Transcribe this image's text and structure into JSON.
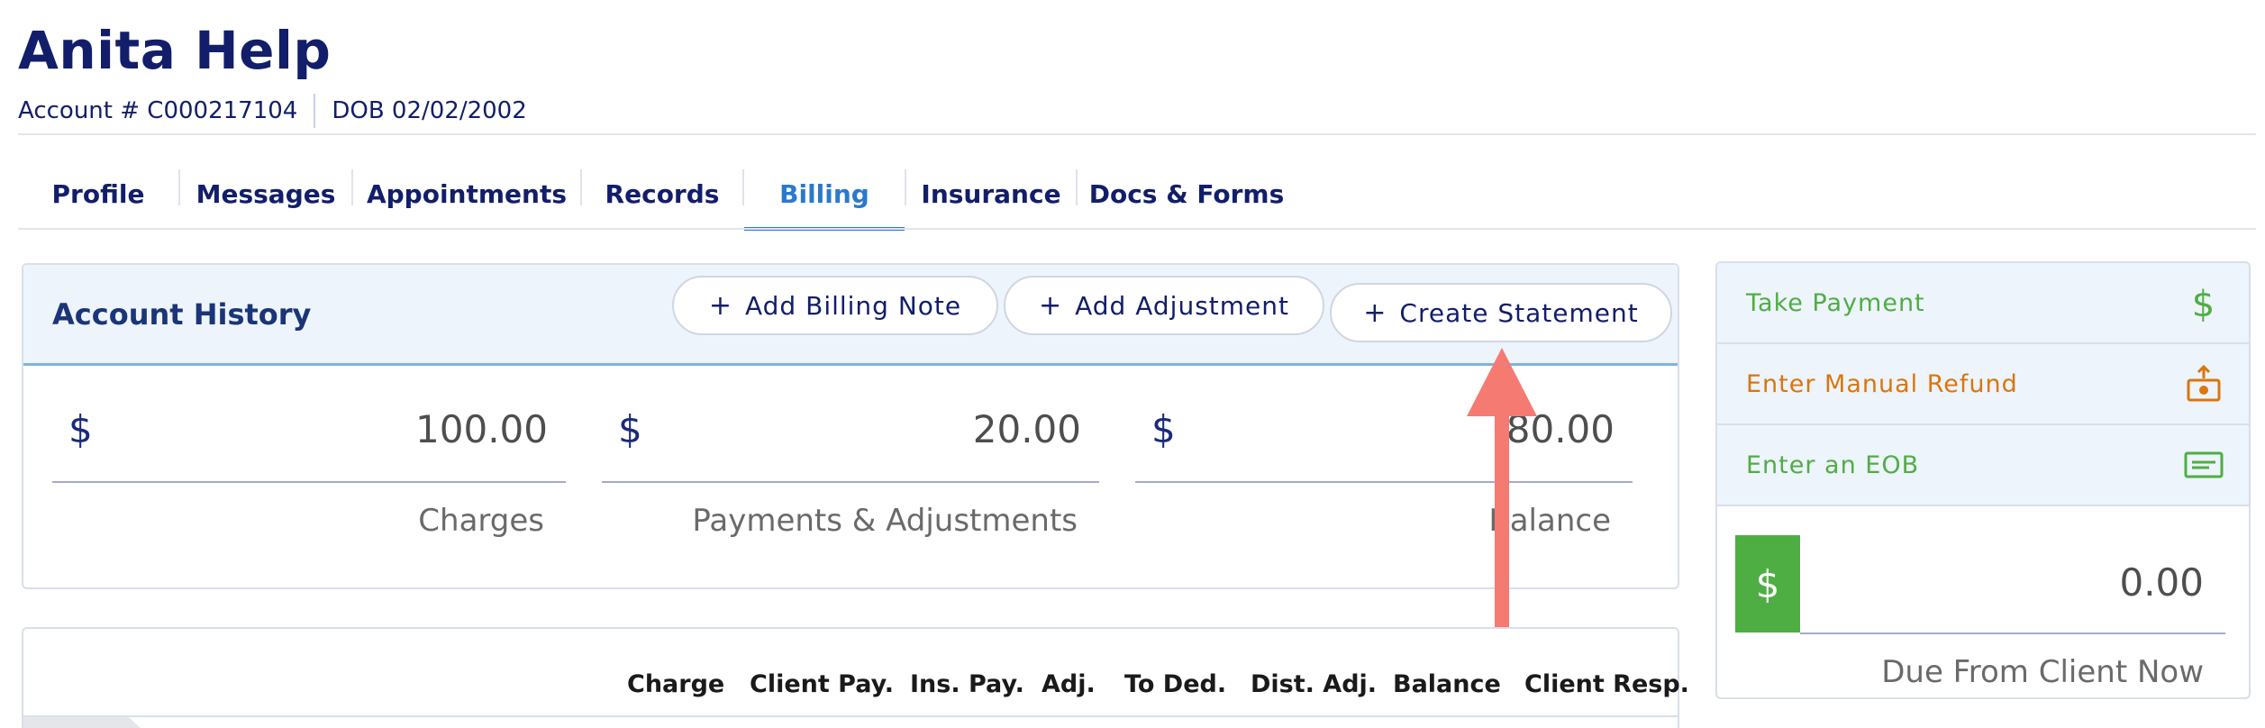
{
  "patient": {
    "name": "Anita Help",
    "account": "Account # C000217104",
    "dob": "DOB 02/02/2002"
  },
  "tabs": [
    {
      "label": "Profile"
    },
    {
      "label": "Messages"
    },
    {
      "label": "Appointments"
    },
    {
      "label": "Records"
    },
    {
      "label": "Billing",
      "active": true
    },
    {
      "label": "Insurance"
    },
    {
      "label": "Docs & Forms"
    }
  ],
  "account_history": {
    "title": "Account History",
    "buttons": {
      "add_note": "Add Billing Note",
      "add_adjustment": "Add Adjustment",
      "create_statement": "Create Statement"
    },
    "stats": [
      {
        "currency": "$",
        "value": "100.00",
        "label": "Charges"
      },
      {
        "currency": "$",
        "value": "20.00",
        "label": "Payments & Adjustments"
      },
      {
        "currency": "$",
        "value": "80.00",
        "label": "Balance"
      }
    ]
  },
  "table": {
    "headers": [
      "Charge",
      "Client Pay.",
      "Ins. Pay.",
      "Adj.",
      "To Ded.",
      "Dist. Adj.",
      "Balance",
      "Client Resp."
    ]
  },
  "side_panel": {
    "take_payment": "Take Payment",
    "manual_refund": "Enter Manual Refund",
    "enter_eob": "Enter an EOB",
    "due_currency": "$",
    "due_value": "0.00",
    "due_label": "Due From Client Now"
  },
  "colors": {
    "primary_text": "#121e6a",
    "active_tab": "#2a79cf",
    "green": "#4eae43",
    "orange": "#d9760f",
    "annotation_arrow": "#f47a72"
  }
}
